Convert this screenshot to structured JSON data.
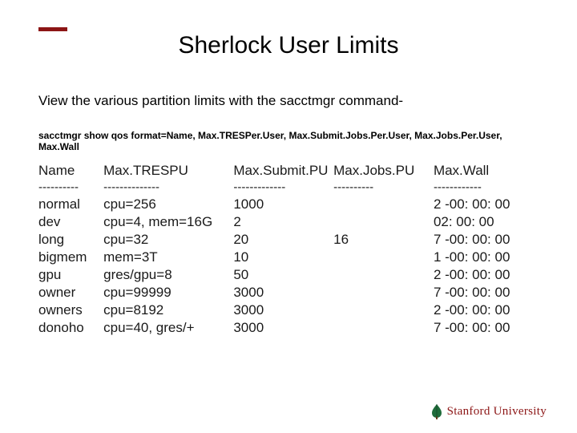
{
  "accent_color": "#8c1515",
  "title": "Sherlock User Limits",
  "subtitle": "View the various partition limits with the sacctmgr command-",
  "command_line": "sacctmgr show qos format=Name, Max.TRESPer.User, Max.Submit.Jobs.Per.User, Max.Jobs.Per.User, Max.Wall",
  "headers": {
    "name": "Name",
    "tres": "Max.TRESPU",
    "submit": "Max.Submit.PU",
    "jobs": "Max.Jobs.PU",
    "wall": "Max.Wall"
  },
  "separators": {
    "name": "----------",
    "tres": "--------------",
    "submit": "-------------",
    "jobs": "----------",
    "wall": "------------"
  },
  "rows": [
    {
      "name": " normal",
      "tres": " cpu=256",
      "submit": "1000",
      "jobs": "",
      "wall": "2 -00: 00: 00"
    },
    {
      "name": " dev",
      "tres": " cpu=4, mem=16G",
      "submit": "2",
      "jobs": "",
      "wall": "02: 00: 00"
    },
    {
      "name": " long",
      "tres": " cpu=32",
      "submit": "20",
      "jobs": "16",
      "wall": "7 -00: 00: 00"
    },
    {
      "name": " bigmem",
      "tres": " mem=3T",
      "submit": "10",
      "jobs": "",
      "wall": "1 -00: 00: 00"
    },
    {
      "name": " gpu",
      "tres": " gres/gpu=8",
      "submit": "50",
      "jobs": "",
      "wall": "2 -00: 00: 00"
    },
    {
      "name": " owner",
      "tres": " cpu=99999",
      "submit": "3000",
      "jobs": "",
      "wall": "7 -00: 00: 00"
    },
    {
      "name": " owners",
      "tres": " cpu=8192",
      "submit": "3000",
      "jobs": "",
      "wall": "2 -00: 00: 00"
    },
    {
      "name": " donoho",
      "tres": " cpu=40, gres/+",
      "submit": "3000",
      "jobs": "",
      "wall": "7 -00: 00: 00"
    }
  ],
  "logo_text": "Stanford University"
}
